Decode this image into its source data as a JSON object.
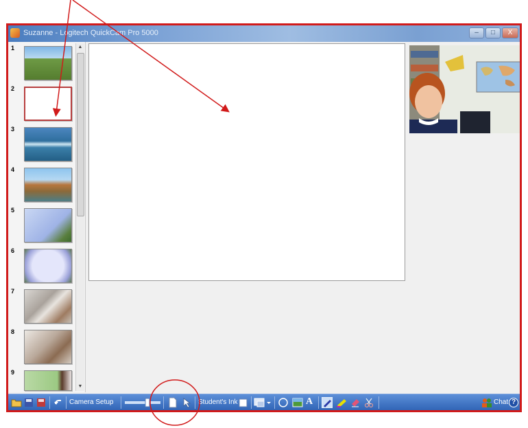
{
  "window": {
    "title": "Suzanne - Logitech QuickCam Pro 5000",
    "controls": {
      "minimize": "–",
      "maximize": "□",
      "close": "X"
    }
  },
  "slides": [
    {
      "number": "1",
      "thumb": "landscape-field",
      "selected": false
    },
    {
      "number": "2",
      "thumb": "blank-white",
      "selected": true
    },
    {
      "number": "3",
      "thumb": "ocean-waves",
      "selected": false
    },
    {
      "number": "4",
      "thumb": "river-gorge",
      "selected": false
    },
    {
      "number": "5",
      "thumb": "blue-frame-flower",
      "selected": false
    },
    {
      "number": "6",
      "thumb": "lavender-frame",
      "selected": false
    },
    {
      "number": "7",
      "thumb": "blurred-room",
      "selected": false
    },
    {
      "number": "8",
      "thumb": "blurred-room-2",
      "selected": false
    },
    {
      "number": "9",
      "thumb": "green-flower",
      "selected": false
    }
  ],
  "toolbar": {
    "camera_setup": "Camera Setup",
    "students_ink": "Student's Ink",
    "text_tool": "A",
    "chat": "Chat",
    "help": "?"
  },
  "colors": {
    "annotation_red": "#d11a1a",
    "toolbar_blue": "#2f63b5",
    "titlebar_blue": "#4a7dbf"
  },
  "icons": [
    "open-icon",
    "save-icon",
    "disk-icon",
    "undo-icon",
    "slider-icon",
    "page-icon",
    "pointer-icon",
    "checkbox-icon",
    "display-icon",
    "circle-tool-icon",
    "image-icon",
    "text-icon",
    "pen-icon",
    "highlighter-icon",
    "eraser-icon",
    "scissors-icon",
    "people-icon",
    "help-icon"
  ]
}
